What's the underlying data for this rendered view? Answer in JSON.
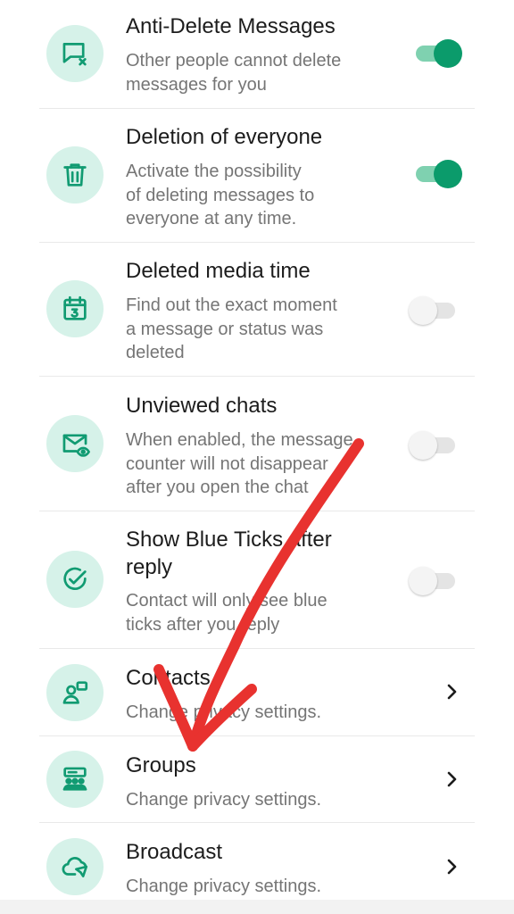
{
  "settings": {
    "anti_delete": {
      "title": "Anti-Delete Messages",
      "subtitle": "Other people cannot delete\nmessages for you",
      "toggle": "on",
      "icon": "message-x-icon"
    },
    "deletion_everyone": {
      "title": "Deletion of everyone",
      "subtitle": "Activate the possibility\nof deleting messages to\neveryone at any time.",
      "toggle": "on",
      "icon": "trash-icon"
    },
    "deleted_media_time": {
      "title": "Deleted media time",
      "subtitle": "Find out the exact moment\na message or status was\ndeleted",
      "toggle": "off",
      "icon": "calendar-icon"
    },
    "unviewed_chats": {
      "title": "Unviewed chats",
      "subtitle": "When enabled, the message\ncounter will not disappear\nafter you open the chat",
      "toggle": "off",
      "icon": "mail-eye-icon"
    },
    "blue_ticks": {
      "title": "Show Blue Ticks after\nreply",
      "subtitle": "Contact will only see blue\nticks after you reply",
      "toggle": "off",
      "icon": "check-circle-icon"
    },
    "contacts": {
      "title": "Contacts",
      "subtitle": "Change privacy settings.",
      "icon": "contact-icon"
    },
    "groups": {
      "title": "Groups",
      "subtitle": "Change privacy settings.",
      "icon": "group-icon"
    },
    "broadcast": {
      "title": "Broadcast",
      "subtitle": "Change privacy settings.",
      "icon": "cloud-send-icon"
    }
  },
  "colors": {
    "accent": "#0b9b6b",
    "accent_light": "#7fd1b0",
    "icon_bg": "#d6f2e9",
    "annotation_arrow": "#e8322f"
  }
}
